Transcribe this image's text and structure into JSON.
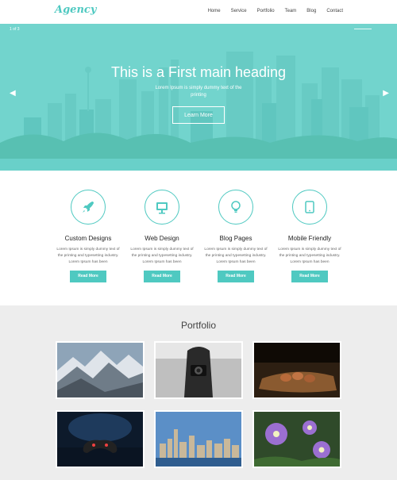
{
  "header": {
    "logo": "Agency",
    "nav": [
      "Home",
      "Service",
      "Portfolio",
      "Team",
      "Blog",
      "Contact"
    ]
  },
  "hero": {
    "counter": "1 of 3",
    "title": "This is a First main heading",
    "subtitle": "Lorem Ipsum is simply dummy text of the printing",
    "button": "Learn More",
    "prev_icon": "chevron-left-icon",
    "next_icon": "chevron-right-icon"
  },
  "services": [
    {
      "icon": "rocket-icon",
      "title": "Custom Designs",
      "text": "Lorem Ipsum is simply dummy text of the printing and typesetting industry. Lorem Ipsum has been",
      "button": "Read More"
    },
    {
      "icon": "monitor-icon",
      "title": "Web Design",
      "text": "Lorem Ipsum is simply dummy text of the printing and typesetting industry. Lorem Ipsum has been",
      "button": "Read More"
    },
    {
      "icon": "lightbulb-icon",
      "title": "Blog Pages",
      "text": "Lorem Ipsum is simply dummy text of the printing and typesetting industry. Lorem Ipsum has been",
      "button": "Read More"
    },
    {
      "icon": "tablet-icon",
      "title": "Mobile Friendly",
      "text": "Lorem Ipsum is simply dummy text of the printing and typesetting industry. Lorem Ipsum has been",
      "button": "Read More"
    }
  ],
  "portfolio": {
    "title": "Portfolio",
    "items": [
      "mountains-photo",
      "camera-photo",
      "nuts-photo",
      "gamepad-photo",
      "city-skyline-photo",
      "purple-flowers-photo"
    ]
  },
  "colors": {
    "accent": "#4fc9c1",
    "portfolio_bg": "#ededed"
  }
}
